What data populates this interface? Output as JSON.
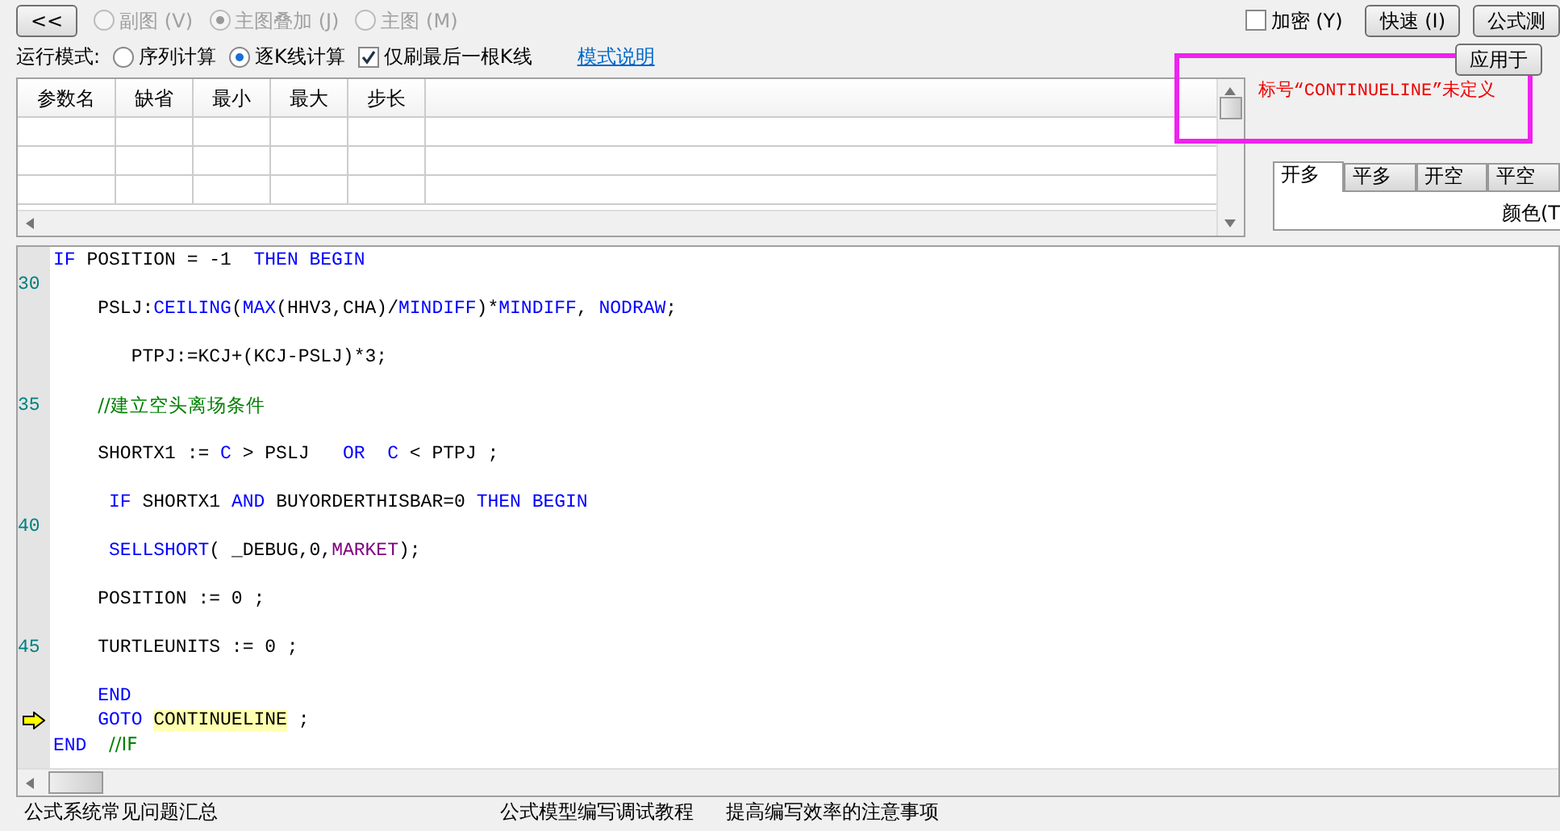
{
  "toolbar": {
    "back_button": "<<",
    "chart_modes": [
      {
        "label": "副图",
        "key": "(V)",
        "selected": false,
        "disabled": true
      },
      {
        "label": "主图叠加",
        "key": "(J)",
        "selected": true,
        "disabled": true
      },
      {
        "label": "主图",
        "key": "(M)",
        "selected": false,
        "disabled": true
      }
    ],
    "encrypt": {
      "label": "加密",
      "key": "(Y)",
      "checked": false
    },
    "buttons": [
      {
        "label": "快速",
        "key": "(I)"
      },
      {
        "label": "公式测"
      }
    ],
    "apply_button": "应用于"
  },
  "run_mode": {
    "label": "运行模式:",
    "options": [
      {
        "label": "序列计算",
        "selected": false
      },
      {
        "label": "逐K线计算",
        "selected": true
      }
    ],
    "refresh_last": {
      "label": "仅刷最后一根K线",
      "checked": true
    },
    "help_link": "模式说明"
  },
  "params_table": {
    "columns": [
      "参数名",
      "缺省",
      "最小",
      "最大",
      "步长"
    ]
  },
  "error_message": "标号“CONTINUELINE”未定义",
  "error_highlight": true,
  "signal_tabs": [
    {
      "label": "开多",
      "selected": true
    },
    {
      "label": "平多",
      "selected": false
    },
    {
      "label": "开空",
      "selected": false
    },
    {
      "label": "平空",
      "selected": false
    }
  ],
  "color_label": "颜色(T",
  "editor": {
    "lines": [
      {
        "blank_after": true,
        "after_number": "30",
        "tokens": [
          {
            "kind": "keyword",
            "text": "IF"
          },
          {
            "kind": "plain",
            "text": " POSITION = -1  "
          },
          {
            "kind": "keyword",
            "text": "THEN BEGIN"
          }
        ]
      },
      {
        "blank_after": true,
        "tokens": [
          {
            "kind": "plain",
            "text": "    PSLJ:"
          },
          {
            "kind": "keyword",
            "text": "CEILING"
          },
          {
            "kind": "plain",
            "text": "("
          },
          {
            "kind": "keyword",
            "text": "MAX"
          },
          {
            "kind": "plain",
            "text": "(HHV3,CHA)/"
          },
          {
            "kind": "keyword",
            "text": "MINDIFF"
          },
          {
            "kind": "plain",
            "text": ")*"
          },
          {
            "kind": "keyword",
            "text": "MINDIFF"
          },
          {
            "kind": "plain",
            "text": ", "
          },
          {
            "kind": "keyword",
            "text": "NODRAW"
          },
          {
            "kind": "plain",
            "text": ";"
          }
        ]
      },
      {
        "blank_after": true,
        "tokens": [
          {
            "kind": "plain",
            "text": "       PTPJ:=KCJ+(KCJ-PSLJ)*3;"
          }
        ]
      },
      {
        "blank_after": true,
        "number": "35",
        "tokens": [
          {
            "kind": "comment",
            "text": "    //建立空头离场条件"
          }
        ]
      },
      {
        "blank_after": true,
        "tokens": [
          {
            "kind": "plain",
            "text": "    SHORTX1 := "
          },
          {
            "kind": "keyword",
            "text": "C"
          },
          {
            "kind": "plain",
            "text": " > PSLJ   "
          },
          {
            "kind": "keyword",
            "text": "OR"
          },
          {
            "kind": "keyword",
            "text": "  C"
          },
          {
            "kind": "plain",
            "text": " < PTPJ ;"
          }
        ]
      },
      {
        "blank_after": true,
        "after_number": "40",
        "tokens": [
          {
            "kind": "keyword",
            "text": "     IF"
          },
          {
            "kind": "plain",
            "text": " SHORTX1 "
          },
          {
            "kind": "keyword",
            "text": "AND"
          },
          {
            "kind": "plain",
            "text": " BUYORDERTHISBAR=0 "
          },
          {
            "kind": "keyword",
            "text": "THEN BEGIN"
          }
        ]
      },
      {
        "blank_after": true,
        "tokens": [
          {
            "kind": "keyword",
            "text": "     SELLSHORT"
          },
          {
            "kind": "plain",
            "text": "( _DEBUG,0,"
          },
          {
            "kind": "constant",
            "text": "MARKET"
          },
          {
            "kind": "plain",
            "text": ");"
          }
        ]
      },
      {
        "blank_after": true,
        "tokens": [
          {
            "kind": "plain",
            "text": "    POSITION := 0 ;"
          }
        ]
      },
      {
        "blank_after": true,
        "number": "45",
        "tokens": [
          {
            "kind": "plain",
            "text": "    TURTLEUNITS := 0 ;"
          }
        ]
      },
      {
        "blank_after": false,
        "tokens": [
          {
            "kind": "keyword",
            "text": "    END"
          }
        ]
      },
      {
        "blank_after": false,
        "current": true,
        "tokens": [
          {
            "kind": "keyword",
            "text": "    GOTO "
          },
          {
            "kind": "error",
            "text": "CONTINUELINE"
          },
          {
            "kind": "plain",
            "text": " ;"
          }
        ]
      },
      {
        "blank_after": false,
        "tokens": [
          {
            "kind": "keyword",
            "text": "END"
          },
          {
            "kind": "comment",
            "text": "  //IF"
          }
        ]
      }
    ]
  },
  "footer_links": [
    "公式系统常见问题汇总",
    "公式模型编写调试教程",
    "提高编写效率的注意事项"
  ]
}
